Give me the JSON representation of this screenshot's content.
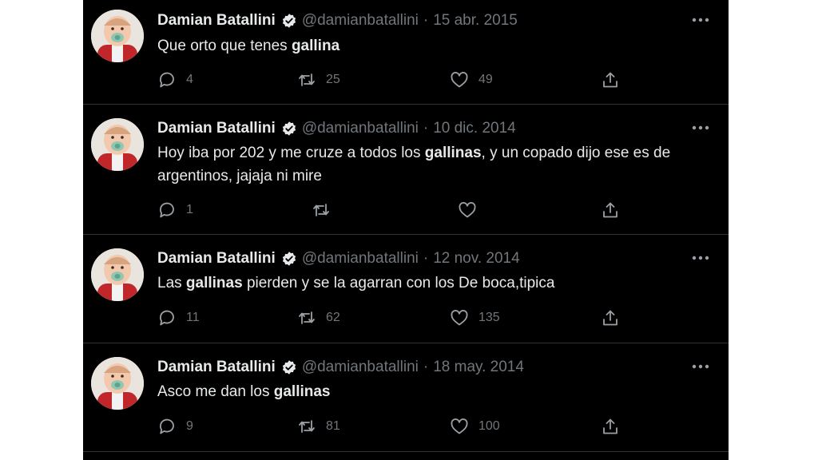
{
  "author": {
    "name": "Damian Batallini",
    "handle": "@damianbatallini",
    "separator": "·",
    "verified_icon": "verified-badge-icon",
    "avatar_icon": "baby-with-pacifier-avatar"
  },
  "colors": {
    "background": "#000000",
    "text": "#e7e9ea",
    "muted": "#71767b",
    "divider": "#2f3336"
  },
  "tweets": [
    {
      "date": "15 abr. 2015",
      "text_parts": [
        "Que orto que tenes ",
        "gallina",
        ""
      ],
      "text_line2": "",
      "replies": "4",
      "retweets": "25",
      "likes": "49"
    },
    {
      "date": "10 dic. 2014",
      "text_parts": [
        "Hoy iba por 202 y me cruze a todos los ",
        "gallinas",
        ", y un copado dijo ese es de"
      ],
      "text_line2": "argentinos, jajaja ni mire",
      "replies": "1",
      "retweets": "",
      "likes": ""
    },
    {
      "date": "12 nov. 2014",
      "text_parts": [
        "Las ",
        "gallinas",
        " pierden y se la agarran con los De boca,tipica"
      ],
      "text_line2": "",
      "replies": "11",
      "retweets": "62",
      "likes": "135"
    },
    {
      "date": "18 may. 2014",
      "text_parts": [
        "Asco me dan los ",
        "gallinas",
        ""
      ],
      "text_line2": "",
      "replies": "9",
      "retweets": "81",
      "likes": "100"
    }
  ]
}
